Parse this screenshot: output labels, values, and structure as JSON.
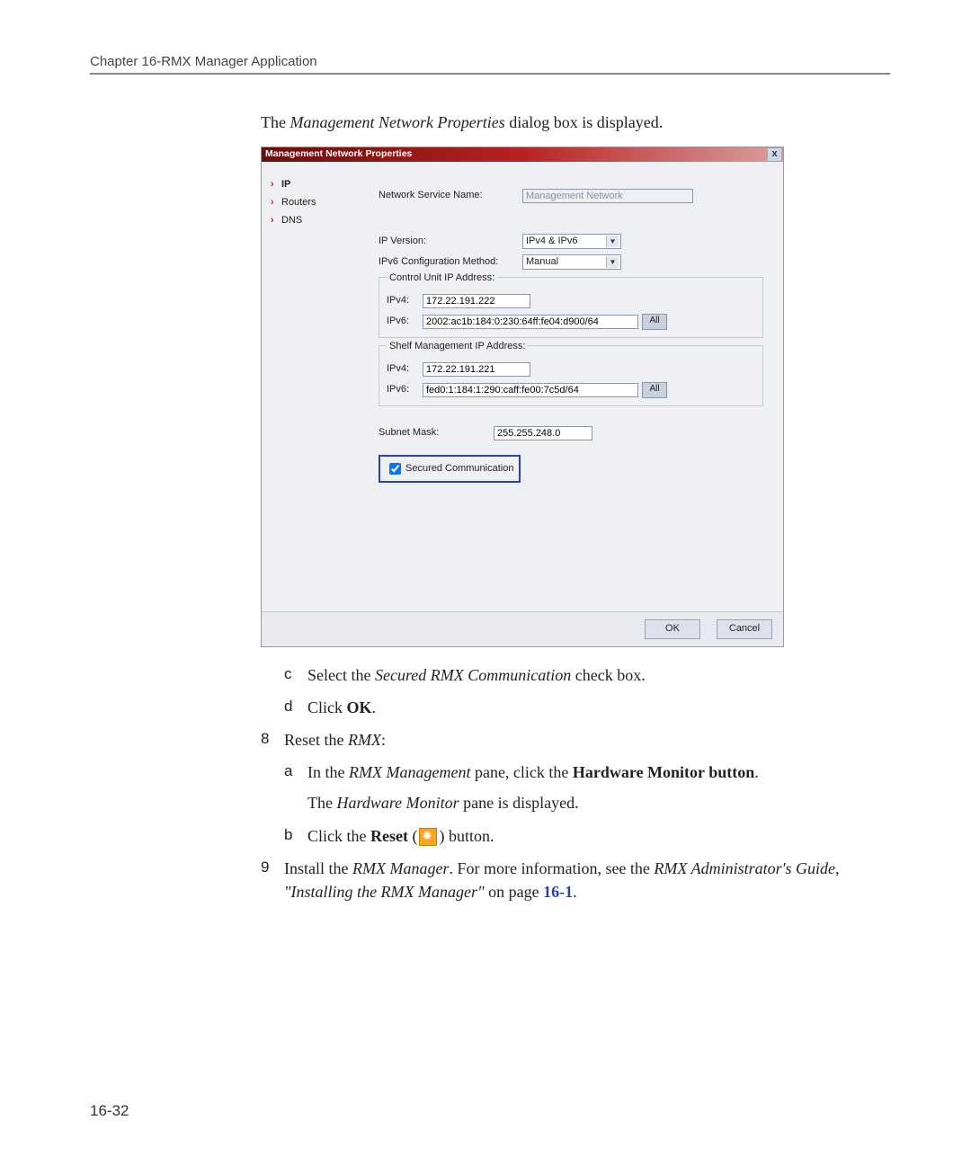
{
  "header": {
    "chapter": "Chapter 16-RMX Manager Application"
  },
  "intro": "The Management Network Properties dialog box is displayed.",
  "dialog": {
    "title": "Management Network Properties",
    "nav": [
      "IP",
      "Routers",
      "DNS"
    ],
    "nsn_label": "Network Service Name:",
    "nsn_value": "Management Network",
    "ipver_label": "IP Version:",
    "ipver_value": "IPv4 & IPv6",
    "ipv6cfg_label": "IPv6 Configuration Method:",
    "ipv6cfg_value": "Manual",
    "cu_legend": "Control Unit IP Address:",
    "cu_ipv4_label": "IPv4:",
    "cu_ipv4_value": "172.22.191.222",
    "cu_ipv6_label": "IPv6:",
    "cu_ipv6_value": "2002:ac1b:184:0:230:64ff:fe04:d900/64",
    "sm_legend": "Shelf Management IP Address:",
    "sm_ipv4_label": "IPv4:",
    "sm_ipv4_value": "172.22.191.221",
    "sm_ipv6_label": "IPv6:",
    "sm_ipv6_value": "fed0:1:184:1:290:caff:fe00:7c5d/64",
    "subnet_label": "Subnet Mask:",
    "subnet_value": "255.255.248.0",
    "secured_label": "Secured Communication",
    "all_btn": "All",
    "ok": "OK",
    "cancel": "Cancel"
  },
  "steps": {
    "c_pre": "Select the ",
    "c_em": "Secured RMX Communication",
    "c_post": " check box.",
    "d_pre": "Click ",
    "d_bold": "OK",
    "d_post": ".",
    "s8_pre": "Reset the ",
    "s8_em": "RMX",
    "s8_post": ":",
    "a_pre": "In the ",
    "a_em": "RMX Management",
    "a_mid": " pane, click the ",
    "a_bold": "Hardware Monitor button",
    "a_post": ".",
    "a2_pre": "The ",
    "a2_em": "Hardware Monitor",
    "a2_post": " pane is displayed.",
    "b_pre": "Click the ",
    "b_bold": "Reset",
    "b_mid": " (",
    "b_post": ") button.",
    "s9_pre": "Install the ",
    "s9_em1": "RMX Manager",
    "s9_mid1": ". For more information, see the ",
    "s9_em2": "RMX Administrator's Guide, \"Installing the RMX Manager\"",
    "s9_mid2": " on page ",
    "s9_link": "16-1",
    "s9_post": "."
  },
  "page_number": "16-32"
}
